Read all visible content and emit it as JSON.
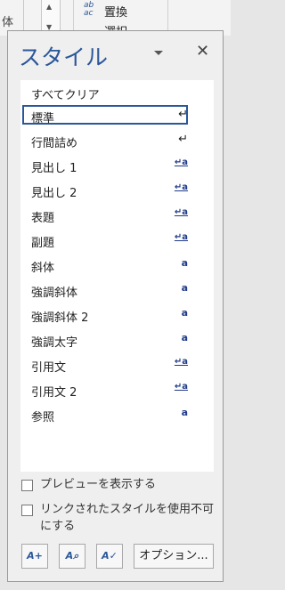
{
  "ribbon": {
    "left_label": "体",
    "scroll_up": "▲",
    "scroll_more": "▼",
    "replace_icon": "ab→ac",
    "replace_label": "置換",
    "select_label": "選択"
  },
  "pane": {
    "title": "スタイル",
    "menu_icon": "dropdown-triangle",
    "close_icon": "✕"
  },
  "styles": [
    {
      "name": "すべてクリア",
      "mark": ""
    },
    {
      "name": "標準",
      "mark": "↵",
      "selected": true
    },
    {
      "name": "行間詰め",
      "mark": "↵"
    },
    {
      "name": "見出し 1",
      "mark": "↵a"
    },
    {
      "name": "見出し 2",
      "mark": "↵a"
    },
    {
      "name": "表題",
      "mark": "↵a"
    },
    {
      "name": "副題",
      "mark": "↵a"
    },
    {
      "name": "斜体",
      "mark": "a"
    },
    {
      "name": "強調斜体",
      "mark": "a"
    },
    {
      "name": "強調斜体 2",
      "mark": "a"
    },
    {
      "name": "強調太字",
      "mark": "a"
    },
    {
      "name": "引用文",
      "mark": "↵a"
    },
    {
      "name": "引用文 2",
      "mark": "↵a"
    },
    {
      "name": "参照",
      "mark": "a"
    }
  ],
  "options": {
    "preview_label": "プレビューを表示する",
    "preview_checked": false,
    "disable_linked_line1": "リンクされたスタイルを使用不可",
    "disable_linked_line2": "にする",
    "disable_linked_checked": false
  },
  "buttons": {
    "new_style_icon": "new-style-icon",
    "style_inspector_icon": "style-inspector-icon",
    "manage_styles_icon": "manage-styles-icon",
    "options_label": "オプション..."
  }
}
